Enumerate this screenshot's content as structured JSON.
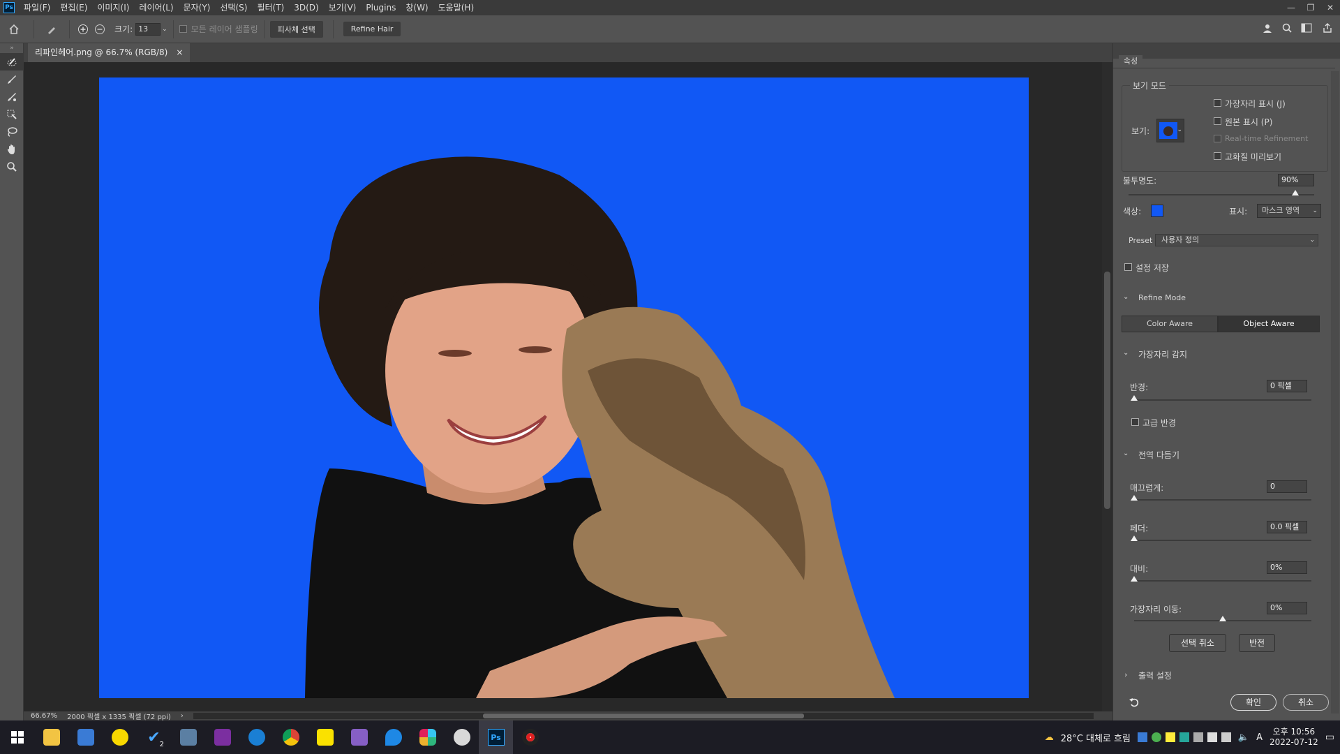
{
  "menu": {
    "logo": "Ps",
    "items": [
      "파일(F)",
      "편집(E)",
      "이미지(I)",
      "레이어(L)",
      "문자(Y)",
      "선택(S)",
      "필터(T)",
      "3D(D)",
      "보기(V)",
      "Plugins",
      "창(W)",
      "도움말(H)"
    ],
    "window_controls": [
      "—",
      "❐",
      "✕"
    ]
  },
  "options": {
    "size_label": "크기:",
    "size_value": "13",
    "sample_all_label": "모든 레이어 샘플링",
    "select_subject": "피사체 선택",
    "refine_hair": "Refine Hair"
  },
  "document": {
    "tab_title": "리파인헤어.png @ 66.7% (RGB/8)",
    "tab_close": "×"
  },
  "status": {
    "zoom": "66.67%",
    "doc_info": "2000 픽셀 x 1335 픽셀 (72 ppi)",
    "arrow": "›"
  },
  "panel": {
    "tab": "속성",
    "view_mode_title": "보기 모드",
    "view_label": "보기:",
    "show_edge": "가장자리 표시 (J)",
    "show_original": "원본 표시 (P)",
    "realtime": "Real-time Refinement",
    "hq_preview": "고화질 미리보기",
    "opacity_label": "불투명도:",
    "opacity_value": "90%",
    "opacity_fraction": 0.9,
    "color_label": "색상:",
    "overlay_color": "#1158f5",
    "display_label": "표시:",
    "display_value": "마스크 영역",
    "preset_label": "Preset",
    "preset_value": "사용자 정의",
    "save_settings": "설정 저장",
    "refine_mode_title": "Refine Mode",
    "color_aware": "Color Aware",
    "object_aware": "Object Aware",
    "edge_detection_title": "가장자리 감지",
    "radius_label": "반경:",
    "radius_value": "0 픽셀",
    "smart_radius": "고급 반경",
    "global_title": "전역 다듬기",
    "smooth_label": "매끄럽게:",
    "smooth_value": "0",
    "feather_label": "페더:",
    "feather_value": "0.0 픽셀",
    "contrast_label": "대비:",
    "contrast_value": "0%",
    "shift_label": "가장자리 이동:",
    "shift_value": "0%",
    "shift_fraction": 0.5,
    "clear_selection": "선택 취소",
    "invert": "반전",
    "output_title": "출력 설정",
    "ok": "확인",
    "cancel": "취소"
  },
  "canvas": {
    "background_color": "#1158f5"
  },
  "taskbar": {
    "weather": "28°C  대체로 흐림",
    "time": "오후 10:56",
    "date": "2022-07-12",
    "badge": "2",
    "ime": "A",
    "ps_label": "Ps"
  }
}
